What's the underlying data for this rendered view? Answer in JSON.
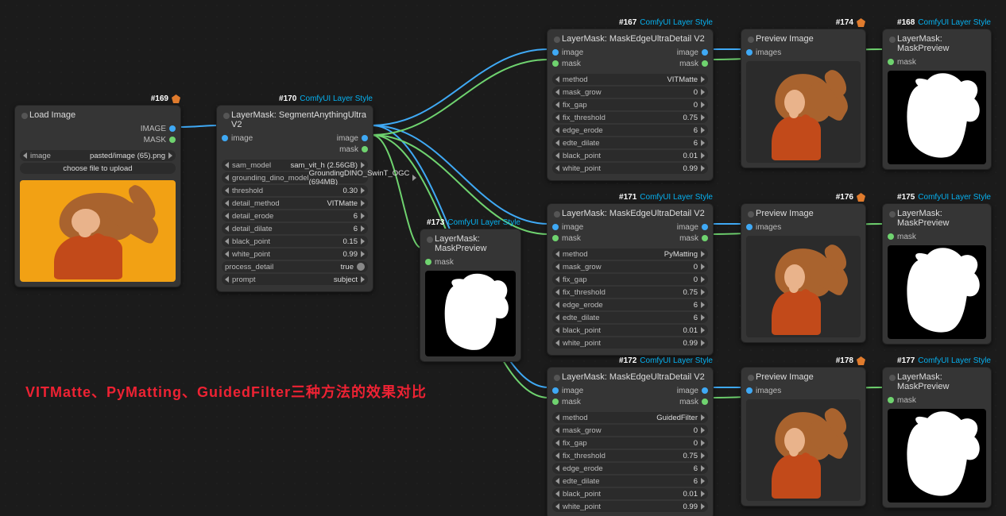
{
  "suite": "ComfyUI Layer Style",
  "note_text": "VITMatte、PyMatting、GuidedFilter三种方法的效果对比",
  "load_image": {
    "id": "#169",
    "title": "Load Image",
    "out_image": "IMAGE",
    "out_mask": "MASK",
    "file_label": "image",
    "file_value": "pasted/image (65).png",
    "upload_btn": "choose file to upload"
  },
  "segment": {
    "id": "#170",
    "title": "LayerMask: SegmentAnythingUltra V2",
    "in_image": "image",
    "out_image": "image",
    "out_mask": "mask",
    "widgets": [
      {
        "l": "sam_model",
        "v": "sam_vit_h (2.56GB)"
      },
      {
        "l": "grounding_dino_model",
        "v": "GroundingDINO_SwinT_OGC (694MB)"
      },
      {
        "l": "threshold",
        "v": "0.30"
      },
      {
        "l": "detail_method",
        "v": "VITMatte"
      },
      {
        "l": "detail_erode",
        "v": "6"
      },
      {
        "l": "detail_dilate",
        "v": "6"
      },
      {
        "l": "black_point",
        "v": "0.15"
      },
      {
        "l": "white_point",
        "v": "0.99"
      },
      {
        "l": "process_detail",
        "v": "true",
        "toggle": true
      },
      {
        "l": "prompt",
        "v": "subject"
      }
    ]
  },
  "mask_preview_173": {
    "id": "#173",
    "title": "LayerMask: MaskPreview",
    "in_mask": "mask"
  },
  "edge_ultra": [
    {
      "id": "#167",
      "title": "LayerMask: MaskEdgeUltraDetail V2",
      "in_image": "image",
      "in_mask": "mask",
      "out_image": "image",
      "out_mask": "mask",
      "widgets": [
        {
          "l": "method",
          "v": "VITMatte"
        },
        {
          "l": "mask_grow",
          "v": "0"
        },
        {
          "l": "fix_gap",
          "v": "0"
        },
        {
          "l": "fix_threshold",
          "v": "0.75"
        },
        {
          "l": "edge_erode",
          "v": "6"
        },
        {
          "l": "edte_dilate",
          "v": "6"
        },
        {
          "l": "black_point",
          "v": "0.01"
        },
        {
          "l": "white_point",
          "v": "0.99"
        }
      ]
    },
    {
      "id": "#171",
      "title": "LayerMask: MaskEdgeUltraDetail V2",
      "in_image": "image",
      "in_mask": "mask",
      "out_image": "image",
      "out_mask": "mask",
      "widgets": [
        {
          "l": "method",
          "v": "PyMatting"
        },
        {
          "l": "mask_grow",
          "v": "0"
        },
        {
          "l": "fix_gap",
          "v": "0"
        },
        {
          "l": "fix_threshold",
          "v": "0.75"
        },
        {
          "l": "edge_erode",
          "v": "6"
        },
        {
          "l": "edte_dilate",
          "v": "6"
        },
        {
          "l": "black_point",
          "v": "0.01"
        },
        {
          "l": "white_point",
          "v": "0.99"
        }
      ]
    },
    {
      "id": "#172",
      "title": "LayerMask: MaskEdgeUltraDetail V2",
      "in_image": "image",
      "in_mask": "mask",
      "out_image": "image",
      "out_mask": "mask",
      "widgets": [
        {
          "l": "method",
          "v": "GuidedFilter"
        },
        {
          "l": "mask_grow",
          "v": "0"
        },
        {
          "l": "fix_gap",
          "v": "0"
        },
        {
          "l": "fix_threshold",
          "v": "0.75"
        },
        {
          "l": "edge_erode",
          "v": "6"
        },
        {
          "l": "edte_dilate",
          "v": "6"
        },
        {
          "l": "black_point",
          "v": "0.01"
        },
        {
          "l": "white_point",
          "v": "0.99"
        }
      ]
    }
  ],
  "preview": [
    {
      "id": "#174",
      "title": "Preview Image",
      "in": "images"
    },
    {
      "id": "#176",
      "title": "Preview Image",
      "in": "images"
    },
    {
      "id": "#178",
      "title": "Preview Image",
      "in": "images"
    }
  ],
  "mask_preview_right": [
    {
      "id": "#168",
      "title": "LayerMask: MaskPreview",
      "in": "mask"
    },
    {
      "id": "#175",
      "title": "LayerMask: MaskPreview",
      "in": "mask"
    },
    {
      "id": "#177",
      "title": "LayerMask: MaskPreview",
      "in": "mask"
    }
  ]
}
